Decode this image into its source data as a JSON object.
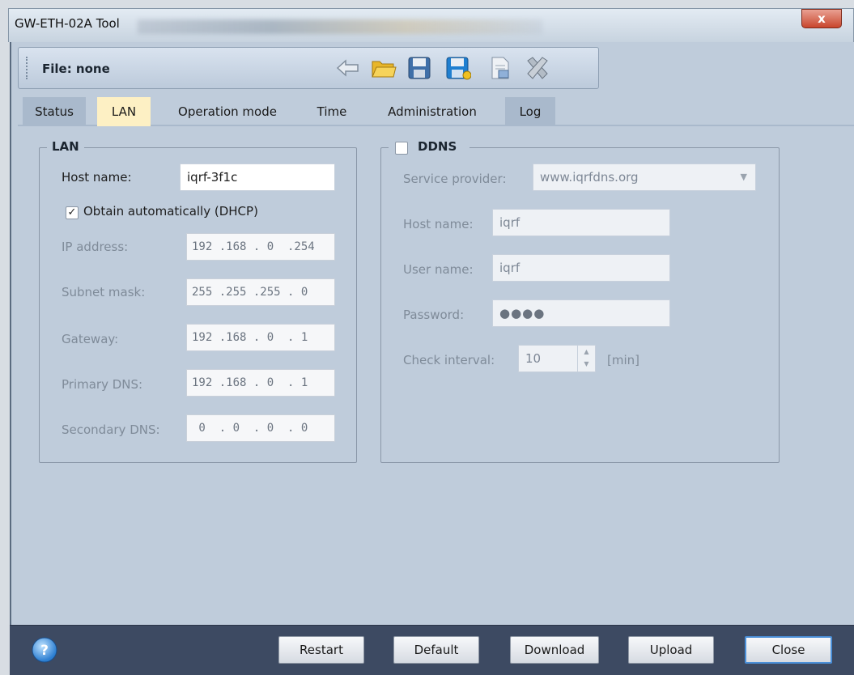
{
  "window": {
    "title": "GW-ETH-02A Tool",
    "close_glyph": "x"
  },
  "toolbar": {
    "file_label": "File: none",
    "icons": [
      "back-arrow-icon",
      "open-folder-icon",
      "save-icon",
      "save-as-icon",
      "document-view-icon",
      "delete-tools-icon"
    ]
  },
  "tabs": [
    {
      "label": "Status",
      "active": false
    },
    {
      "label": "LAN",
      "active": true
    },
    {
      "label": "Operation mode",
      "active": false
    },
    {
      "label": "Time",
      "active": false
    },
    {
      "label": "Administration",
      "active": false
    },
    {
      "label": "Log",
      "active": false
    }
  ],
  "lan": {
    "title": "LAN",
    "host_name_label": "Host name:",
    "host_name_value": "iqrf-3f1c",
    "dhcp_label": "Obtain automatically (DHCP)",
    "dhcp_checked": true,
    "ip_label": "IP address:",
    "ip_value": "192 .168 . 0  .254",
    "subnet_label": "Subnet mask:",
    "subnet_value": "255 .255 .255 . 0",
    "gateway_label": "Gateway:",
    "gateway_value": "192 .168 . 0  . 1",
    "primary_dns_label": "Primary DNS:",
    "primary_dns_value": "192 .168 . 0  . 1",
    "secondary_dns_label": "Secondary DNS:",
    "secondary_dns_value": " 0  . 0  . 0  . 0"
  },
  "ddns": {
    "title": "DDNS",
    "enabled": false,
    "service_provider_label": "Service provider:",
    "service_provider_value": "www.iqrfdns.org",
    "host_name_label": "Host name:",
    "host_name_value": "iqrf",
    "user_name_label": "User name:",
    "user_name_value": "iqrf",
    "password_label": "Password:",
    "password_value": "●●●●",
    "check_interval_label": "Check interval:",
    "check_interval_value": "10",
    "check_interval_unit": "[min]"
  },
  "buttons": {
    "restart": "Restart",
    "default": "Default",
    "download": "Download",
    "upload": "Upload",
    "close": "Close"
  },
  "colors": {
    "client_bg": "#bfccdb",
    "active_tab": "#fdf0c4",
    "bottom_bar": "#3d4a62",
    "close_button_red": "#c9462d"
  }
}
